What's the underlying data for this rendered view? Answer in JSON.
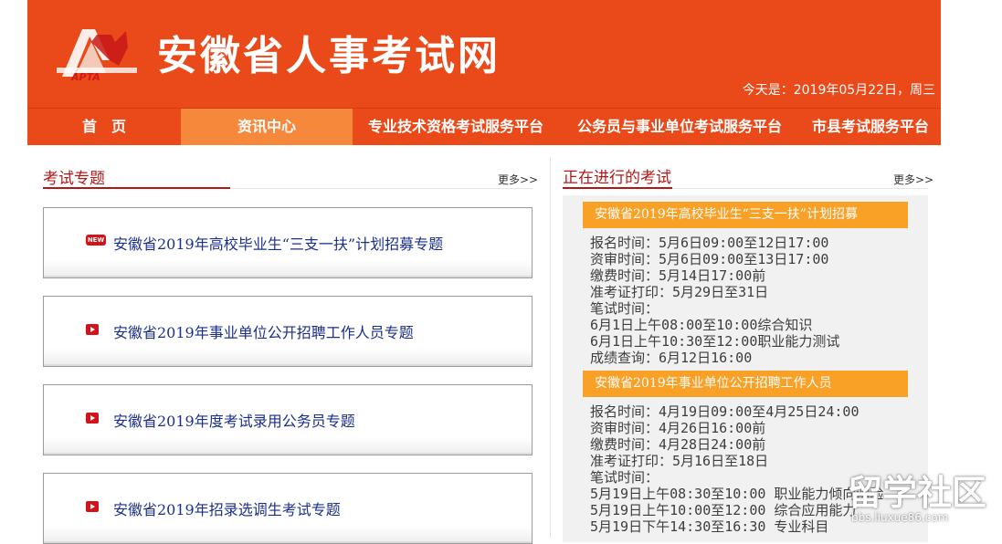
{
  "header": {
    "site_title": "安徽省人事考试网",
    "logo_text": "APTA",
    "date_text": "今天是：2019年05月22日，周三"
  },
  "nav": {
    "items": [
      {
        "label": "首　页"
      },
      {
        "label": "资讯中心"
      },
      {
        "label": "专业技术资格考试服务平台"
      },
      {
        "label": "公务员与事业单位考试服务平台"
      },
      {
        "label": "市县考试服务平台"
      }
    ]
  },
  "exam_topics": {
    "title": "考试专题",
    "more": "更多>>",
    "items": [
      {
        "label": "安徽省2019年高校毕业生“三支一扶”计划招募专题",
        "badge": "NEW"
      },
      {
        "label": "安徽省2019年事业单位公开招聘工作人员专题"
      },
      {
        "label": "安徽省2019年度考试录用公务员专题"
      },
      {
        "label": "安徽省2019年招录选调生考试专题"
      }
    ]
  },
  "ongoing_exams": {
    "title": "正在进行的考试",
    "more": "更多>>",
    "exams": [
      {
        "name": "安徽省2019年高校毕业生“三支一扶”计划招募",
        "lines": [
          "报名时间：5月6日09:00至12日17:00",
          "资审时间：5月6日09:00至13日17:00",
          "缴费时间：5月14日17:00前",
          "准考证打印：5月29日至31日",
          "笔试时间：",
          "6月1日上午08:00至10:00综合知识",
          "6月1日上午10:30至12:00职业能力测试",
          "成绩查询：6月12日16:00"
        ]
      },
      {
        "name": "安徽省2019年事业单位公开招聘工作人员",
        "lines": [
          "报名时间：4月19日09:00至4月25日24:00",
          "资审时间：4月26日16:00前",
          "缴费时间：4月28日24:00前",
          "准考证打印：5月16日至18日",
          "笔试时间：",
          "5月19日上午08:30至10:00 职业能力倾向测验",
          "5月19日上午10:00至12:00 综合应用能力",
          "5月19日下午14:30至16:30 专业科目"
        ]
      }
    ]
  },
  "watermark": {
    "big": "留学社区",
    "small": "bbs.liuxue86.com"
  }
}
